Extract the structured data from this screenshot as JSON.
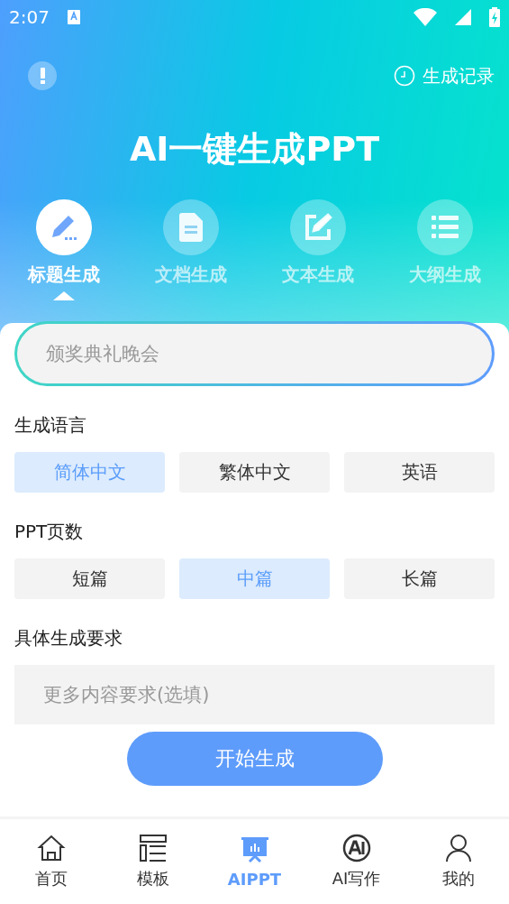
{
  "status_bar": {
    "time": "2:07"
  },
  "header": {
    "history_label": "生成记录",
    "title": "AI一键生成PPT"
  },
  "modes": [
    {
      "label": "标题生成",
      "selected": true
    },
    {
      "label": "文档生成",
      "selected": false
    },
    {
      "label": "文本生成",
      "selected": false
    },
    {
      "label": "大纲生成",
      "selected": false
    }
  ],
  "topic_field": {
    "placeholder": "颁奖典礼晚会"
  },
  "language": {
    "label": "生成语言",
    "options": [
      {
        "label": "简体中文",
        "selected": true
      },
      {
        "label": "繁体中文",
        "selected": false
      },
      {
        "label": "英语",
        "selected": false
      }
    ]
  },
  "page_count": {
    "label": "PPT页数",
    "options": [
      {
        "label": "短篇",
        "selected": false
      },
      {
        "label": "中篇",
        "selected": true
      },
      {
        "label": "长篇",
        "selected": false
      }
    ]
  },
  "requirements": {
    "label": "具体生成要求",
    "placeholder": "更多内容要求(选填)"
  },
  "start_button": "开始生成",
  "bottom_nav": [
    {
      "label": "首页",
      "selected": false
    },
    {
      "label": "模板",
      "selected": false
    },
    {
      "label": "AIPPT",
      "selected": true
    },
    {
      "label": "AI写作",
      "selected": false
    },
    {
      "label": "我的",
      "selected": false
    }
  ]
}
